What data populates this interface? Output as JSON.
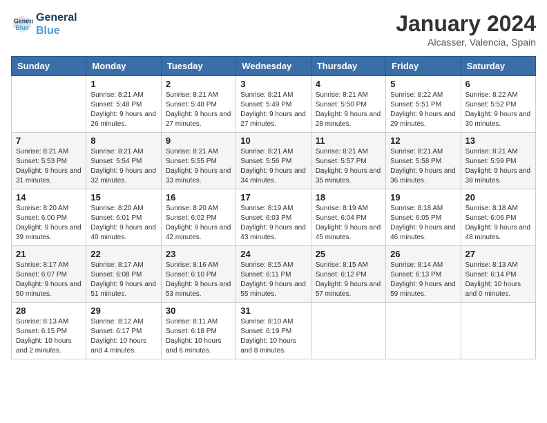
{
  "logo": {
    "line1": "General",
    "line2": "Blue"
  },
  "title": "January 2024",
  "subtitle": "Alcasser, Valencia, Spain",
  "header": {
    "days": [
      "Sunday",
      "Monday",
      "Tuesday",
      "Wednesday",
      "Thursday",
      "Friday",
      "Saturday"
    ]
  },
  "weeks": [
    [
      {
        "day": "",
        "sunrise": "",
        "sunset": "",
        "daylight": ""
      },
      {
        "day": "1",
        "sunrise": "Sunrise: 8:21 AM",
        "sunset": "Sunset: 5:48 PM",
        "daylight": "Daylight: 9 hours and 26 minutes."
      },
      {
        "day": "2",
        "sunrise": "Sunrise: 8:21 AM",
        "sunset": "Sunset: 5:48 PM",
        "daylight": "Daylight: 9 hours and 27 minutes."
      },
      {
        "day": "3",
        "sunrise": "Sunrise: 8:21 AM",
        "sunset": "Sunset: 5:49 PM",
        "daylight": "Daylight: 9 hours and 27 minutes."
      },
      {
        "day": "4",
        "sunrise": "Sunrise: 8:21 AM",
        "sunset": "Sunset: 5:50 PM",
        "daylight": "Daylight: 9 hours and 28 minutes."
      },
      {
        "day": "5",
        "sunrise": "Sunrise: 8:22 AM",
        "sunset": "Sunset: 5:51 PM",
        "daylight": "Daylight: 9 hours and 29 minutes."
      },
      {
        "day": "6",
        "sunrise": "Sunrise: 8:22 AM",
        "sunset": "Sunset: 5:52 PM",
        "daylight": "Daylight: 9 hours and 30 minutes."
      }
    ],
    [
      {
        "day": "7",
        "sunrise": "Sunrise: 8:21 AM",
        "sunset": "Sunset: 5:53 PM",
        "daylight": "Daylight: 9 hours and 31 minutes."
      },
      {
        "day": "8",
        "sunrise": "Sunrise: 8:21 AM",
        "sunset": "Sunset: 5:54 PM",
        "daylight": "Daylight: 9 hours and 32 minutes."
      },
      {
        "day": "9",
        "sunrise": "Sunrise: 8:21 AM",
        "sunset": "Sunset: 5:55 PM",
        "daylight": "Daylight: 9 hours and 33 minutes."
      },
      {
        "day": "10",
        "sunrise": "Sunrise: 8:21 AM",
        "sunset": "Sunset: 5:56 PM",
        "daylight": "Daylight: 9 hours and 34 minutes."
      },
      {
        "day": "11",
        "sunrise": "Sunrise: 8:21 AM",
        "sunset": "Sunset: 5:57 PM",
        "daylight": "Daylight: 9 hours and 35 minutes."
      },
      {
        "day": "12",
        "sunrise": "Sunrise: 8:21 AM",
        "sunset": "Sunset: 5:58 PM",
        "daylight": "Daylight: 9 hours and 36 minutes."
      },
      {
        "day": "13",
        "sunrise": "Sunrise: 8:21 AM",
        "sunset": "Sunset: 5:59 PM",
        "daylight": "Daylight: 9 hours and 38 minutes."
      }
    ],
    [
      {
        "day": "14",
        "sunrise": "Sunrise: 8:20 AM",
        "sunset": "Sunset: 6:00 PM",
        "daylight": "Daylight: 9 hours and 39 minutes."
      },
      {
        "day": "15",
        "sunrise": "Sunrise: 8:20 AM",
        "sunset": "Sunset: 6:01 PM",
        "daylight": "Daylight: 9 hours and 40 minutes."
      },
      {
        "day": "16",
        "sunrise": "Sunrise: 8:20 AM",
        "sunset": "Sunset: 6:02 PM",
        "daylight": "Daylight: 9 hours and 42 minutes."
      },
      {
        "day": "17",
        "sunrise": "Sunrise: 8:19 AM",
        "sunset": "Sunset: 6:03 PM",
        "daylight": "Daylight: 9 hours and 43 minutes."
      },
      {
        "day": "18",
        "sunrise": "Sunrise: 8:19 AM",
        "sunset": "Sunset: 6:04 PM",
        "daylight": "Daylight: 9 hours and 45 minutes."
      },
      {
        "day": "19",
        "sunrise": "Sunrise: 8:18 AM",
        "sunset": "Sunset: 6:05 PM",
        "daylight": "Daylight: 9 hours and 46 minutes."
      },
      {
        "day": "20",
        "sunrise": "Sunrise: 8:18 AM",
        "sunset": "Sunset: 6:06 PM",
        "daylight": "Daylight: 9 hours and 48 minutes."
      }
    ],
    [
      {
        "day": "21",
        "sunrise": "Sunrise: 8:17 AM",
        "sunset": "Sunset: 6:07 PM",
        "daylight": "Daylight: 9 hours and 50 minutes."
      },
      {
        "day": "22",
        "sunrise": "Sunrise: 8:17 AM",
        "sunset": "Sunset: 6:08 PM",
        "daylight": "Daylight: 9 hours and 51 minutes."
      },
      {
        "day": "23",
        "sunrise": "Sunrise: 8:16 AM",
        "sunset": "Sunset: 6:10 PM",
        "daylight": "Daylight: 9 hours and 53 minutes."
      },
      {
        "day": "24",
        "sunrise": "Sunrise: 8:15 AM",
        "sunset": "Sunset: 6:11 PM",
        "daylight": "Daylight: 9 hours and 55 minutes."
      },
      {
        "day": "25",
        "sunrise": "Sunrise: 8:15 AM",
        "sunset": "Sunset: 6:12 PM",
        "daylight": "Daylight: 9 hours and 57 minutes."
      },
      {
        "day": "26",
        "sunrise": "Sunrise: 8:14 AM",
        "sunset": "Sunset: 6:13 PM",
        "daylight": "Daylight: 9 hours and 59 minutes."
      },
      {
        "day": "27",
        "sunrise": "Sunrise: 8:13 AM",
        "sunset": "Sunset: 6:14 PM",
        "daylight": "Daylight: 10 hours and 0 minutes."
      }
    ],
    [
      {
        "day": "28",
        "sunrise": "Sunrise: 8:13 AM",
        "sunset": "Sunset: 6:15 PM",
        "daylight": "Daylight: 10 hours and 2 minutes."
      },
      {
        "day": "29",
        "sunrise": "Sunrise: 8:12 AM",
        "sunset": "Sunset: 6:17 PM",
        "daylight": "Daylight: 10 hours and 4 minutes."
      },
      {
        "day": "30",
        "sunrise": "Sunrise: 8:11 AM",
        "sunset": "Sunset: 6:18 PM",
        "daylight": "Daylight: 10 hours and 6 minutes."
      },
      {
        "day": "31",
        "sunrise": "Sunrise: 8:10 AM",
        "sunset": "Sunset: 6:19 PM",
        "daylight": "Daylight: 10 hours and 8 minutes."
      },
      {
        "day": "",
        "sunrise": "",
        "sunset": "",
        "daylight": ""
      },
      {
        "day": "",
        "sunrise": "",
        "sunset": "",
        "daylight": ""
      },
      {
        "day": "",
        "sunrise": "",
        "sunset": "",
        "daylight": ""
      }
    ]
  ]
}
